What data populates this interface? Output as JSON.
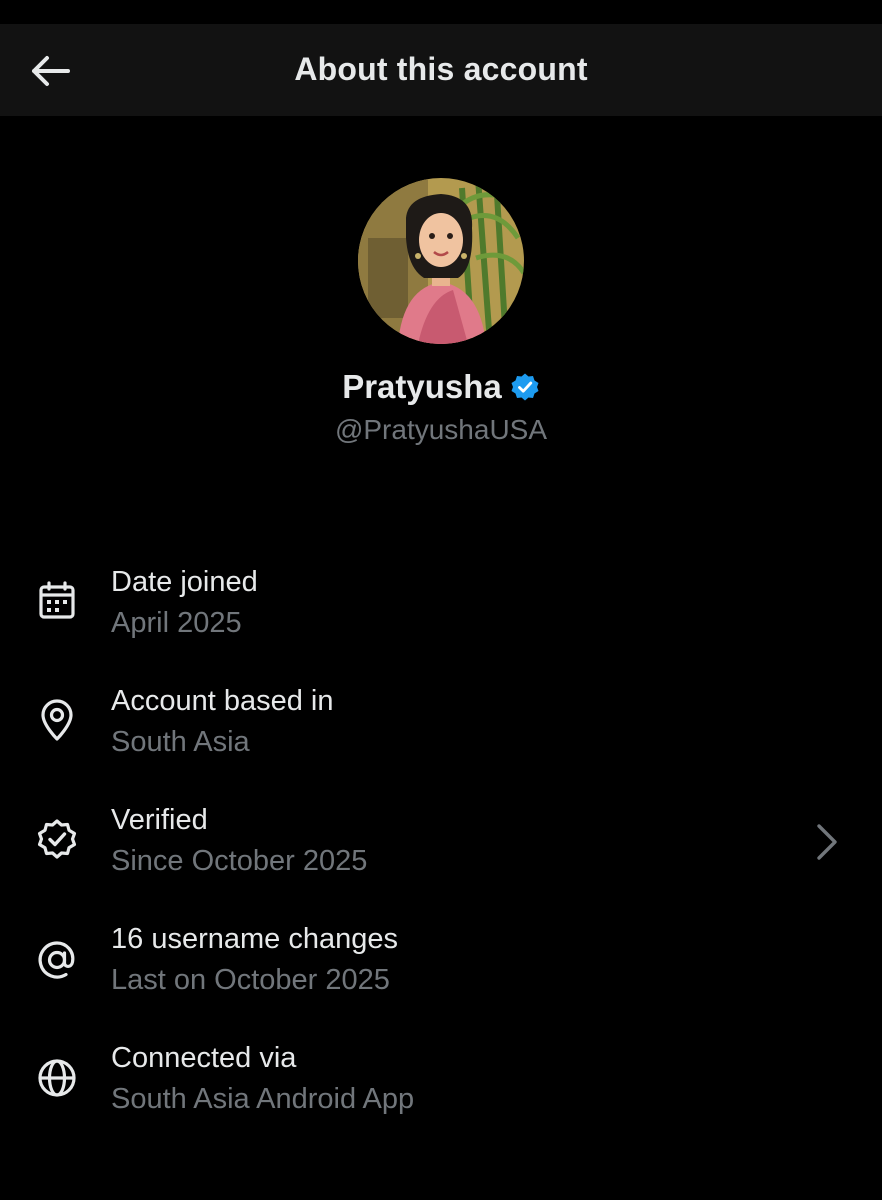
{
  "header": {
    "title": "About this account",
    "back_icon": "arrow-left-icon"
  },
  "profile": {
    "display_name": "Pratyusha",
    "handle": "@PratyushaUSA",
    "verified_badge_color": "#1d9bf0",
    "avatar_icon": "avatar-illustration"
  },
  "details": [
    {
      "icon": "calendar-icon",
      "label": "Date joined",
      "value": "April 2025"
    },
    {
      "icon": "location-pin-icon",
      "label": "Account based in",
      "value": "South Asia"
    },
    {
      "icon": "verified-badge-outline-icon",
      "label": "Verified",
      "value": "Since October 2025",
      "chevron_icon": "chevron-right-icon"
    },
    {
      "icon": "at-sign-icon",
      "label": "16 username changes",
      "value": "Last on October 2025"
    },
    {
      "icon": "globe-icon",
      "label": "Connected via",
      "value": "South Asia Android App"
    }
  ],
  "colors": {
    "background": "#000000",
    "header_background": "#121212",
    "primary_text": "#e7e9ea",
    "secondary_text": "#71767b",
    "accent": "#1d9bf0"
  }
}
